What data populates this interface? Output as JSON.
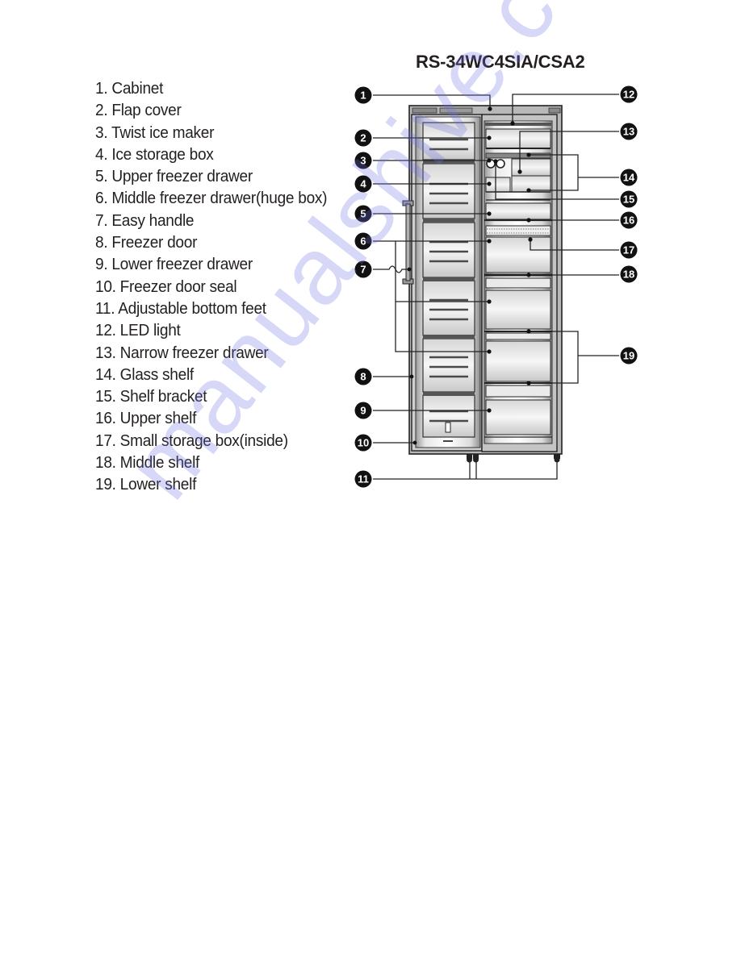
{
  "document": {
    "model_title": "RS-34WC4SIA/CSA2",
    "parts": [
      {
        "number": 1,
        "label": "1. Cabinet"
      },
      {
        "number": 2,
        "label": "2. Flap cover"
      },
      {
        "number": 3,
        "label": "3. Twist ice maker"
      },
      {
        "number": 4,
        "label": "4. Ice storage box"
      },
      {
        "number": 5,
        "label": "5. Upper freezer drawer"
      },
      {
        "number": 6,
        "label": "6. Middle freezer drawer(huge box)"
      },
      {
        "number": 7,
        "label": "7. Easy handle"
      },
      {
        "number": 8,
        "label": "8. Freezer door"
      },
      {
        "number": 9,
        "label": "9. Lower freezer drawer"
      },
      {
        "number": 10,
        "label": "10. Freezer door seal"
      },
      {
        "number": 11,
        "label": "11. Adjustable bottom feet"
      },
      {
        "number": 12,
        "label": "12. LED light"
      },
      {
        "number": 13,
        "label": "13. Narrow freezer drawer"
      },
      {
        "number": 14,
        "label": "14. Glass shelf"
      },
      {
        "number": 15,
        "label": "15. Shelf bracket"
      },
      {
        "number": 16,
        "label": "16. Upper shelf"
      },
      {
        "number": 17,
        "label": "17. Small storage box(inside)"
      },
      {
        "number": 18,
        "label": "18. Middle shelf"
      },
      {
        "number": 19,
        "label": "19. Lower shelf"
      }
    ]
  },
  "diagram": {
    "callouts_left": [
      "1",
      "2",
      "3",
      "4",
      "5",
      "6",
      "7",
      "8",
      "9",
      "10",
      "11"
    ],
    "callouts_right": [
      "12",
      "13",
      "14",
      "15",
      "16",
      "17",
      "18",
      "19"
    ]
  },
  "watermark": {
    "text": "manualshive.com",
    "color": "#6e6ee6"
  }
}
